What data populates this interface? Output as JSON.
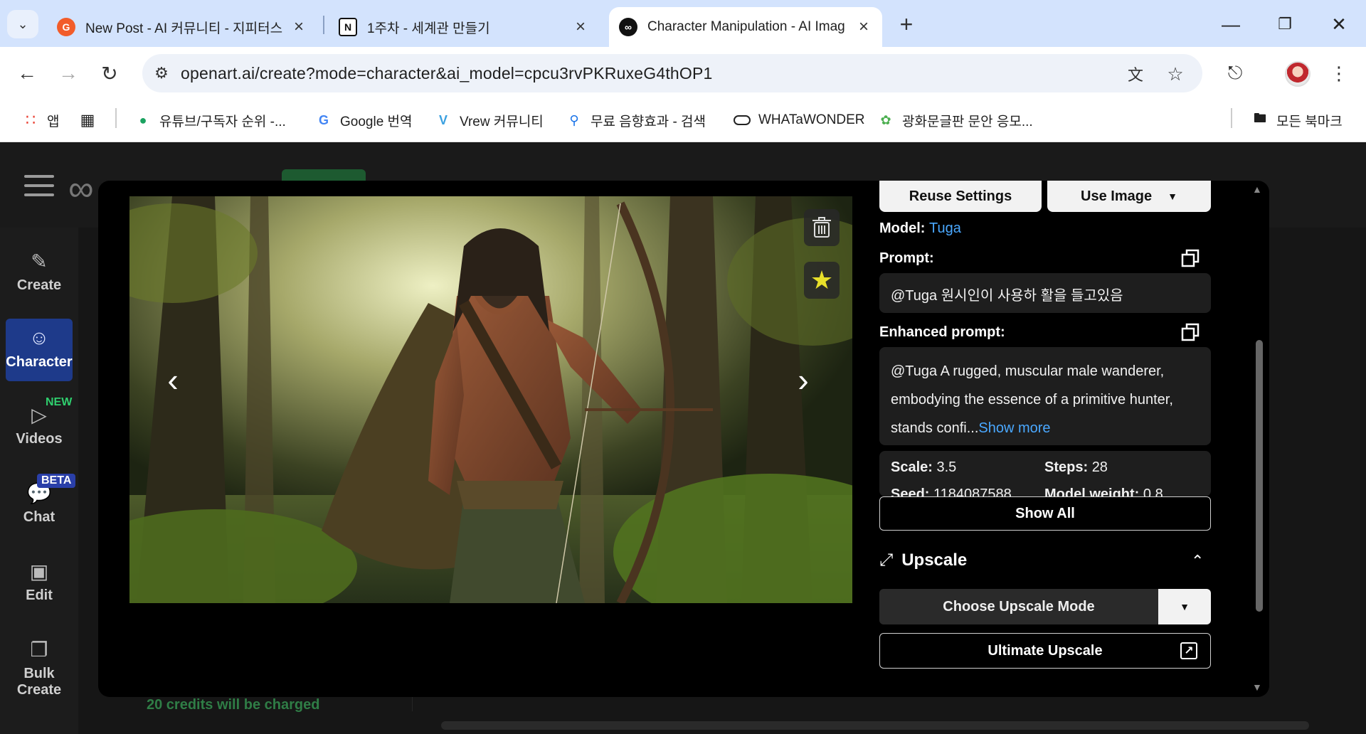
{
  "browser": {
    "tabs": [
      {
        "title": "New Post - AI 커뮤니티 - 지피터스",
        "favicon": "gpters-icon",
        "color": "#f25c2a"
      },
      {
        "title": "1주차 - 세계관 만들기",
        "favicon": "notion-icon",
        "color": "#111111"
      },
      {
        "title": "Character Manipulation - AI Imag",
        "favicon": "openart-icon",
        "color": "#111111"
      }
    ],
    "url": "openart.ai/create?mode=character&ai_model=cpcu3rvPKRuxeG4thOP1",
    "bookmarks": [
      {
        "label": "앱",
        "icon": "apps-grid-icon"
      },
      {
        "label": "",
        "icon": "tab-groups-icon"
      },
      {
        "label": "유튜브/구독자 순위 -...",
        "icon": "chart-icon"
      },
      {
        "label": "Google 번역",
        "icon": "google-translate-icon"
      },
      {
        "label": "Vrew 커뮤니티",
        "icon": "vrew-icon"
      },
      {
        "label": "무료 음향효과 - 검색",
        "icon": "search-icon"
      },
      {
        "label": "WHATaWONDER",
        "icon": "whatawonder-icon"
      },
      {
        "label": "광화문글판 문안 응모...",
        "icon": "leaf-icon"
      }
    ],
    "all_bookmarks": "모든 북마크"
  },
  "app": {
    "sidebar": [
      {
        "label": "Create",
        "icon": "create-icon"
      },
      {
        "label": "Character",
        "icon": "character-icon"
      },
      {
        "label": "Videos",
        "icon": "video-icon",
        "badge": "NEW"
      },
      {
        "label": "Chat",
        "icon": "chat-icon",
        "badge": "BETA"
      },
      {
        "label": "Edit",
        "icon": "edit-icon"
      },
      {
        "label": "Bulk\nCreate",
        "icon": "bulk-create-icon"
      }
    ],
    "credits_note": "20 credits will be charged"
  },
  "modal": {
    "reuse_settings": "Reuse Settings",
    "use_image": "Use Image",
    "model_label": "Model:",
    "model_value": "Tuga",
    "prompt_label": "Prompt:",
    "prompt_text": "@Tuga 원시인이 사용하 활을 들고있음",
    "enhanced_label": "Enhanced prompt:",
    "enhanced_text": "@Tuga A rugged, muscular male wanderer, embodying the essence of a primitive hunter, stands confi...",
    "show_more": "Show more",
    "params": {
      "scale_label": "Scale:",
      "scale_value": "3.5",
      "steps_label": "Steps:",
      "steps_value": "28",
      "seed_label": "Seed:",
      "seed_value": "1184087588",
      "weight_label": "Model weight:",
      "weight_value": "0.8"
    },
    "show_all": "Show All",
    "upscale_title": "Upscale",
    "choose_upscale": "Choose Upscale Mode",
    "ultimate_upscale": "Ultimate Upscale"
  },
  "colors": {
    "accent_link": "#4aa8ff",
    "active_nav": "#1e3a8a",
    "star": "#e8e02a"
  }
}
